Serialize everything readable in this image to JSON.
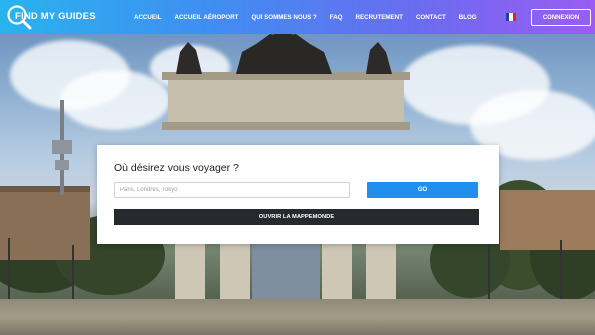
{
  "brand": {
    "logo_text": "FIND MY GUIDES"
  },
  "nav": {
    "items": [
      {
        "label": "ACCUEIL"
      },
      {
        "label": "ACCUEIL AÉROPORT"
      },
      {
        "label": "QUI SOMMES NOUS ?"
      },
      {
        "label": "FAQ"
      },
      {
        "label": "RECRUTEMENT"
      },
      {
        "label": "CONTACT"
      },
      {
        "label": "BLOG"
      }
    ],
    "language_flag": "france-flag-icon",
    "flag_colors": [
      "#1d3e9a",
      "#ffffff",
      "#e1251b"
    ],
    "login_label": "CONNEXION"
  },
  "search": {
    "title": "Où désirez vous voyager ?",
    "placeholder": "Paris, Londres, Tokyo",
    "value": "",
    "go_label": "GO",
    "map_button_label": "OUVRIR LA MAPPEMONDE"
  },
  "colors": {
    "nav_gradient": [
      "#29b3ee",
      "#9b5cf2"
    ],
    "go_button": "#1f90f0",
    "map_button": "#26292d"
  },
  "background": {
    "subject": "arch-monument-photo"
  }
}
